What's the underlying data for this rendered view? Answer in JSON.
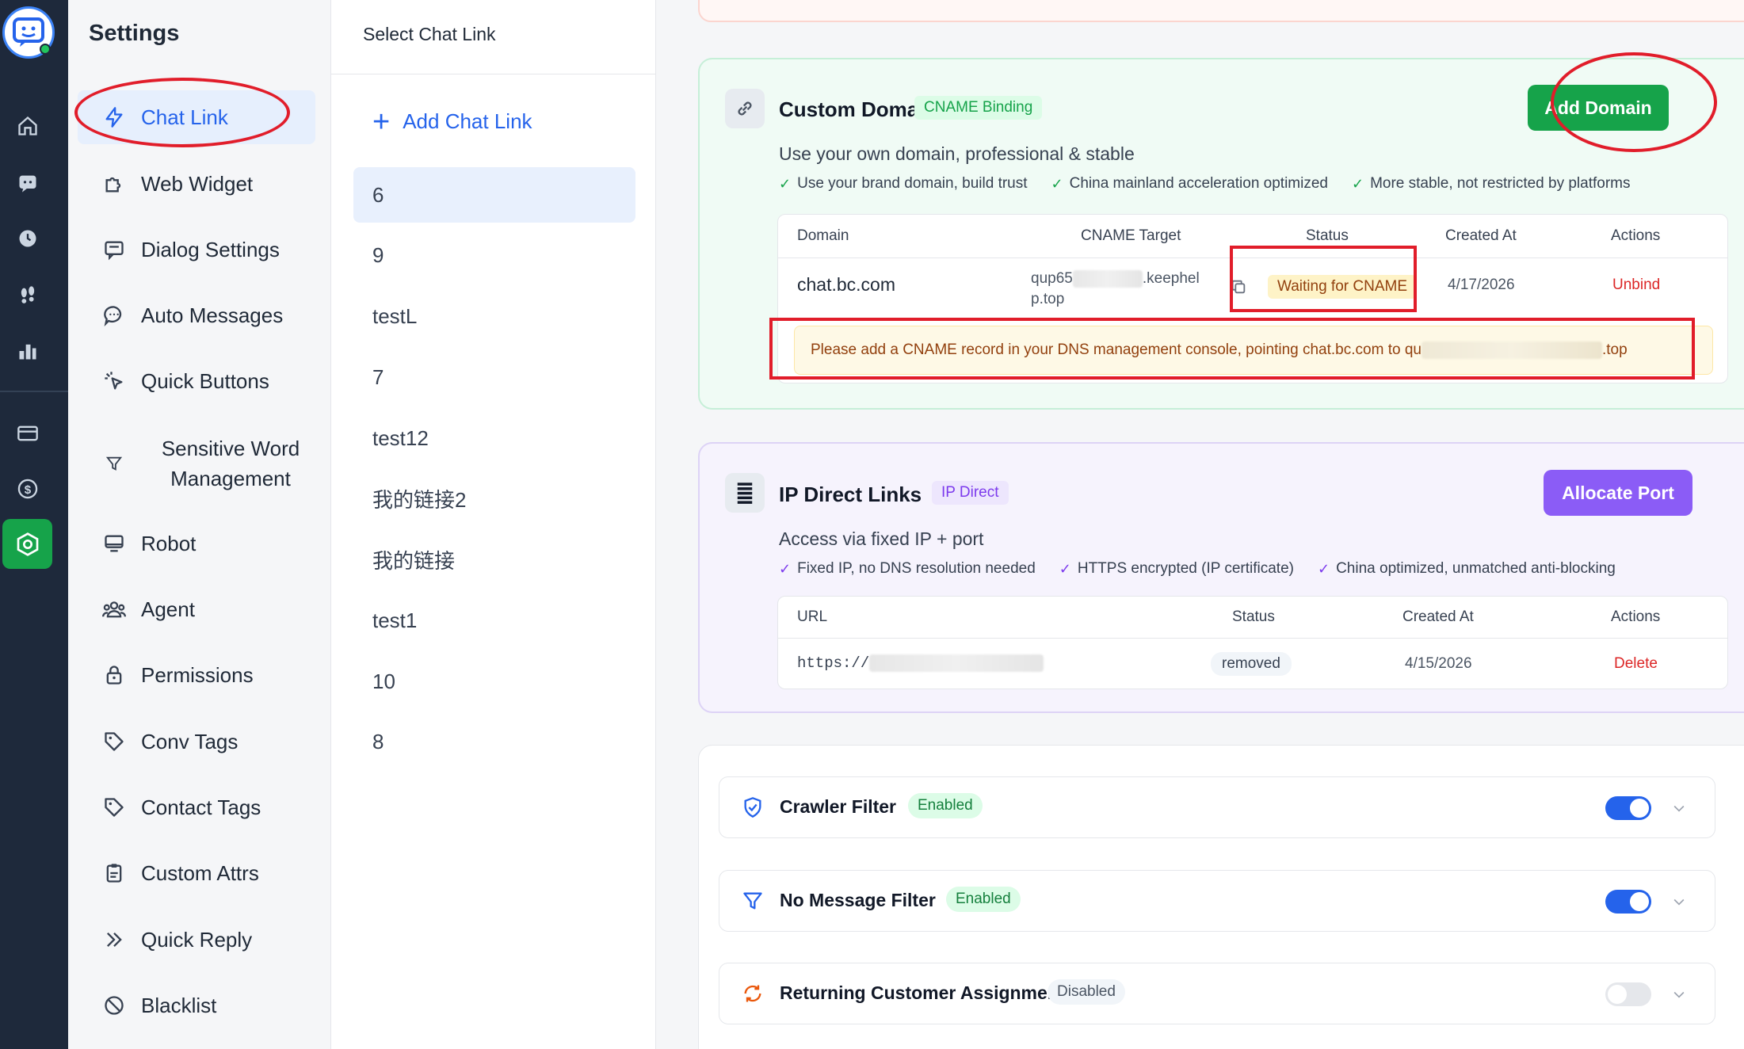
{
  "rail": {
    "icons": [
      "home-icon",
      "chat-icon",
      "history-icon",
      "footprints-icon",
      "bar-chart-icon",
      "card-icon",
      "dollar-icon",
      "settings-hexagon-icon"
    ]
  },
  "menu": {
    "title": "Settings",
    "items": [
      {
        "label": "Chat Link",
        "icon": "lightning-icon"
      },
      {
        "label": "Web Widget",
        "icon": "puzzle-icon"
      },
      {
        "label": "Dialog Settings",
        "icon": "dialog-icon"
      },
      {
        "label": "Auto Messages",
        "icon": "message-icon"
      },
      {
        "label": "Quick Buttons",
        "icon": "pointer-click-icon"
      },
      {
        "label": "Sensitive Word Management",
        "icon": "filter-icon"
      },
      {
        "label": "Robot",
        "icon": "monitor-icon"
      },
      {
        "label": "Agent",
        "icon": "users-icon"
      },
      {
        "label": "Permissions",
        "icon": "lock-icon"
      },
      {
        "label": "Conv Tags",
        "icon": "tag-icon"
      },
      {
        "label": "Contact Tags",
        "icon": "tag-icon"
      },
      {
        "label": "Custom Attrs",
        "icon": "clipboard-icon"
      },
      {
        "label": "Quick Reply",
        "icon": "double-chevron-icon"
      },
      {
        "label": "Blacklist",
        "icon": "ban-icon"
      }
    ]
  },
  "links": {
    "header": "Select Chat Link",
    "add_label": "Add Chat Link",
    "items": [
      "6",
      "9",
      "testL",
      "7",
      "test12",
      "我的链接2",
      "我的链接",
      "test1",
      "10",
      "8"
    ]
  },
  "custom_domain": {
    "title": "Custom Domain",
    "badge": "CNAME Binding",
    "subtitle": "Use your own domain, professional & stable",
    "features": [
      "Use your brand domain, build trust",
      "China mainland acceleration optimized",
      "More stable, not restricted by platforms"
    ],
    "button": "Add Domain",
    "columns": [
      "Domain",
      "CNAME Target",
      "Status",
      "Created At",
      "Actions"
    ],
    "row": {
      "domain": "chat.bc.com",
      "cname_prefix": "qup65",
      "cname_suffix_1": ".keephel",
      "cname_suffix_2": "p.top",
      "status": "Waiting for CNAME",
      "created": "4/17/2026",
      "action": "Unbind"
    },
    "hint_prefix": "Please add a CNAME record in your DNS management console, pointing chat.bc.com to qu",
    "hint_suffix": ".top"
  },
  "ip_direct": {
    "title": "IP Direct Links",
    "badge": "IP Direct",
    "subtitle": "Access via fixed IP + port",
    "features": [
      "Fixed IP, no DNS resolution needed",
      "HTTPS encrypted (IP certificate)",
      "China optimized, unmatched anti-blocking"
    ],
    "button": "Allocate Port",
    "columns": [
      "URL",
      "Status",
      "Created At",
      "Actions"
    ],
    "row": {
      "url": "https://",
      "status": "removed",
      "created": "4/15/2026",
      "action": "Delete"
    }
  },
  "filters": [
    {
      "label": "Crawler Filter",
      "badge": "Enabled",
      "enabled": true,
      "icon": "shield-check-icon"
    },
    {
      "label": "No Message Filter",
      "badge": "Enabled",
      "enabled": true,
      "icon": "funnel-icon"
    },
    {
      "label": "Returning Customer Assignment",
      "badge": "Disabled",
      "enabled": false,
      "icon": "refresh-icon"
    }
  ],
  "colors": {
    "accent": "#2563eb",
    "success": "#16a34a",
    "purple": "#8b5cf6",
    "danger": "#dc2626",
    "annotation": "#e11d2a"
  }
}
